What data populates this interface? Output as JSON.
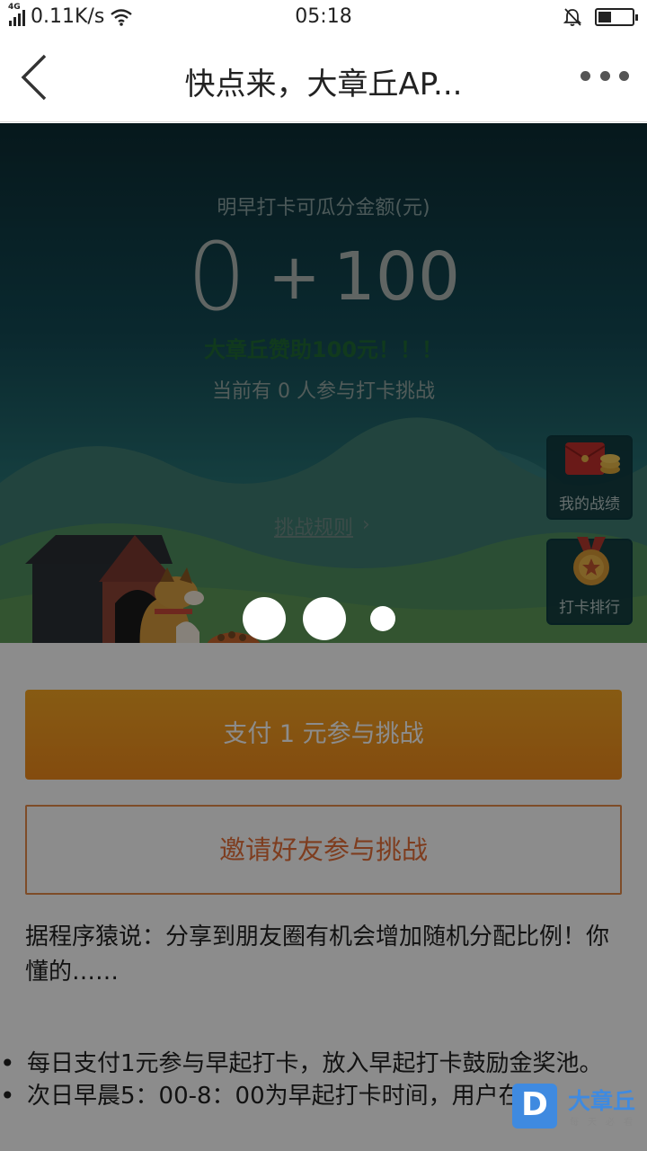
{
  "status_bar": {
    "network_tag": "4G",
    "speed": "0.11K/s",
    "time": "05:18",
    "battery_level": 0.4
  },
  "navbar": {
    "title": "快点来，大章丘AP..."
  },
  "hero": {
    "subtitle": "明早打卡可瓜分金额(元)",
    "amount_base": "0",
    "amount_plus": "+",
    "amount_bonus": "100",
    "sponsor_text": "大章丘赞助100元！！！",
    "participants_text": "当前有 0 人参与打卡挑战",
    "rules_link": "挑战规则",
    "side_buttons": {
      "my_record": "我的战绩",
      "ranking": "打卡排行"
    }
  },
  "actions": {
    "pay_label": "支付 1 元参与挑战",
    "invite_label": "邀请好友参与挑战"
  },
  "tip_text": "据程序猿说：分享到朋友圈有机会增加随机分配比例！你懂的……",
  "rules": [
    "每日支付1元参与早起打卡，放入早起打卡鼓励金奖池。",
    "次日早晨5：00-8：00为早起打卡时间，用户在期"
  ],
  "watermark": {
    "brand": "大章丘",
    "slogan": "每天必看"
  },
  "colors": {
    "accent_orange": "#f39a1f",
    "invite_border": "#e58a4a",
    "sponsor_green": "#1f6a35",
    "hero_top": "#0c2d34"
  }
}
